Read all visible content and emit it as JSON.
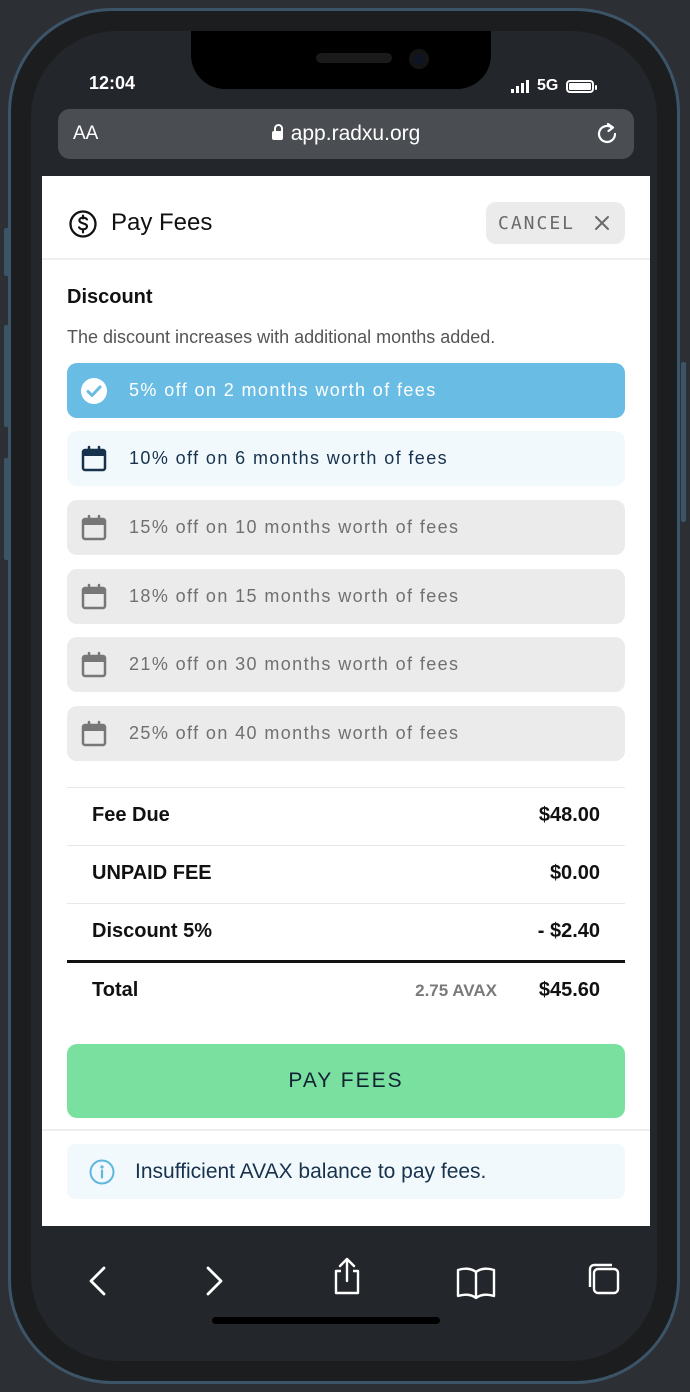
{
  "status": {
    "time": "12:04",
    "network": "5G"
  },
  "browser": {
    "text_size_label": "AA",
    "url": "app.radxu.org"
  },
  "modal": {
    "title": "Pay Fees",
    "cancel_label": "CANCEL",
    "discount": {
      "heading": "Discount",
      "description": "The discount increases with additional months added.",
      "options": [
        {
          "label": "5% off on 2 months worth of fees",
          "state": "selected"
        },
        {
          "label": "10% off on 6 months worth of fees",
          "state": "available"
        },
        {
          "label": "15% off on 10 months worth of fees",
          "state": "disabled"
        },
        {
          "label": "18% off on 15 months worth of fees",
          "state": "disabled"
        },
        {
          "label": "21% off on 30 months worth of fees",
          "state": "disabled"
        },
        {
          "label": "25% off on 40 months worth of fees",
          "state": "disabled"
        }
      ]
    },
    "summary": {
      "fee_due": {
        "label": "Fee Due",
        "value": "$48.00"
      },
      "unpaid_fee": {
        "label": "UNPAID FEE",
        "value": "$0.00"
      },
      "discount": {
        "label": "Discount 5%",
        "value": "- $2.40"
      },
      "total": {
        "label": "Total",
        "avax": "2.75 AVAX",
        "value": "$45.60"
      }
    },
    "pay_button_label": "PAY FEES",
    "info_message": "Insufficient AVAX balance to pay fees."
  },
  "colors": {
    "selected_option": "#69bce3",
    "available_option": "#f2f9fd",
    "disabled_option": "#ebebeb",
    "pay_button": "#7ae0a0",
    "info_icon": "#5fb7e0"
  },
  "icons": {
    "status": [
      "signal-icon",
      "battery-icon"
    ],
    "browser": [
      "lock-icon",
      "reload-icon"
    ],
    "modal": [
      "dollar-circle-icon",
      "close-icon",
      "check-circle-icon",
      "calendar-icon",
      "info-icon"
    ],
    "toolbar": [
      "back-icon",
      "forward-icon",
      "share-icon",
      "bookmarks-icon",
      "tabs-icon"
    ]
  }
}
